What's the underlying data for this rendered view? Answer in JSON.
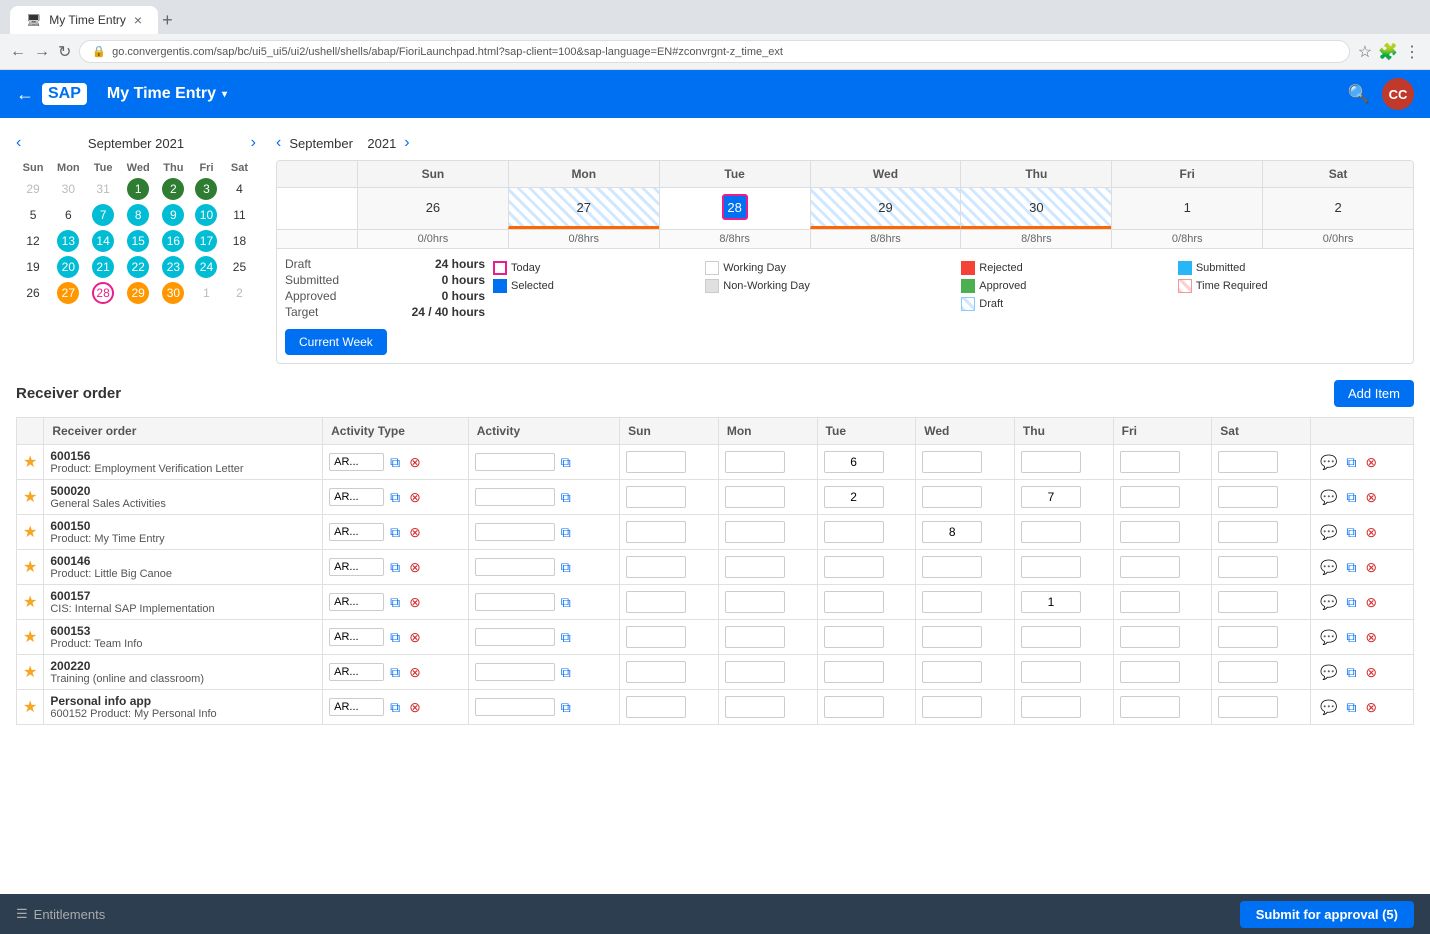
{
  "browser": {
    "tab_title": "My Time Entry",
    "url": "go.convergentis.com/sap/bc/ui5_ui5/ui2/ushell/shells/abap/FioriLaunchpad.html?sap-client=100&sap-language=EN#zconvrgnt-z_time_ext",
    "new_tab_label": "+",
    "back_label": "←",
    "forward_label": "→",
    "refresh_label": "↻"
  },
  "header": {
    "logo_text": "SAP",
    "back_label": "←",
    "title": "My Time Entry",
    "dropdown_arrow": "▾",
    "search_label": "🔍",
    "user_initials": "CC"
  },
  "mini_calendar": {
    "nav_prev": "‹",
    "nav_next": "›",
    "month": "September",
    "year": "2021",
    "day_headers": [
      "Sun",
      "Mon",
      "Tue",
      "Wed",
      "Thu",
      "Fri",
      "Sat"
    ],
    "weeks": [
      [
        {
          "d": "29",
          "style": "muted"
        },
        {
          "d": "30",
          "style": "muted"
        },
        {
          "d": "31",
          "style": "muted"
        },
        {
          "d": "1",
          "style": "green"
        },
        {
          "d": "2",
          "style": "green"
        },
        {
          "d": "3",
          "style": "green"
        },
        {
          "d": "4",
          "style": ""
        }
      ],
      [
        {
          "d": "5",
          "style": ""
        },
        {
          "d": "6",
          "style": ""
        },
        {
          "d": "7",
          "style": "teal"
        },
        {
          "d": "8",
          "style": "teal"
        },
        {
          "d": "9",
          "style": "teal"
        },
        {
          "d": "10",
          "style": "teal"
        },
        {
          "d": "11",
          "style": ""
        }
      ],
      [
        {
          "d": "12",
          "style": ""
        },
        {
          "d": "13",
          "style": "teal"
        },
        {
          "d": "14",
          "style": "teal"
        },
        {
          "d": "15",
          "style": "teal"
        },
        {
          "d": "16",
          "style": "teal"
        },
        {
          "d": "17",
          "style": "teal"
        },
        {
          "d": "18",
          "style": ""
        }
      ],
      [
        {
          "d": "19",
          "style": ""
        },
        {
          "d": "20",
          "style": "teal"
        },
        {
          "d": "21",
          "style": "teal"
        },
        {
          "d": "22",
          "style": "teal"
        },
        {
          "d": "23",
          "style": "teal"
        },
        {
          "d": "24",
          "style": "teal"
        },
        {
          "d": "25",
          "style": ""
        }
      ],
      [
        {
          "d": "26",
          "style": ""
        },
        {
          "d": "27",
          "style": "orange"
        },
        {
          "d": "28",
          "style": "today"
        },
        {
          "d": "29",
          "style": "orange"
        },
        {
          "d": "30",
          "style": "orange"
        },
        {
          "d": "1",
          "style": "muted"
        },
        {
          "d": "2",
          "style": "muted"
        }
      ]
    ]
  },
  "week_calendar": {
    "nav_prev": "‹",
    "nav_next": "›",
    "month": "September",
    "year": "2021",
    "day_columns": [
      "",
      "Sun",
      "Mon",
      "Tue",
      "Wed",
      "Thu",
      "Fri",
      "Sat"
    ],
    "dates": [
      "",
      "26",
      "27",
      "28",
      "29",
      "30",
      "1",
      "2"
    ],
    "hours_row": [
      "",
      "0/0hrs",
      "0/8hrs",
      "8/8hrs",
      "8/8hrs",
      "8/8hrs",
      "0/8hrs",
      "0/0hrs"
    ],
    "stats": {
      "draft_label": "Draft",
      "draft_value": "24 hours",
      "submitted_label": "Submitted",
      "submitted_value": "0 hours",
      "approved_label": "Approved",
      "approved_value": "0 hours",
      "target_label": "Target",
      "target_value": "24 / 40 hours"
    },
    "legend": [
      {
        "label": "Today",
        "style": "today"
      },
      {
        "label": "Working Day",
        "style": "working"
      },
      {
        "label": "Rejected",
        "style": "rejected"
      },
      {
        "label": "Submitted",
        "style": "submitted"
      },
      {
        "label": "Selected",
        "style": "selected"
      },
      {
        "label": "Non-Working Day",
        "style": "nonworking"
      },
      {
        "label": "Approved",
        "style": "approved"
      },
      {
        "label": "Time Required",
        "style": "timerequired"
      },
      {
        "label": "",
        "style": ""
      },
      {
        "label": "",
        "style": ""
      },
      {
        "label": "",
        "style": "draft"
      },
      {
        "label": "Draft",
        "style": "draft"
      }
    ],
    "current_week_btn": "Current Week"
  },
  "receiver_section": {
    "title": "Receiver order",
    "add_item_btn": "Add Item"
  },
  "table": {
    "headers": [
      "",
      "Receiver order",
      "Activity Type",
      "Activity",
      "Sun",
      "Mon",
      "Tue",
      "Wed",
      "Thu",
      "Fri",
      "Sat",
      ""
    ],
    "rows": [
      {
        "star": "★",
        "num": "600156",
        "desc": "Product: Employment Verification Letter",
        "activity_type": "AR...",
        "activity": "",
        "sun": "",
        "mon": "",
        "tue": "6",
        "wed": "",
        "thu": "",
        "fri": "",
        "sat": ""
      },
      {
        "star": "★",
        "num": "500020",
        "desc": "General Sales Activities",
        "activity_type": "AR...",
        "activity": "",
        "sun": "",
        "mon": "",
        "tue": "2",
        "wed": "",
        "thu": "7",
        "fri": "",
        "sat": ""
      },
      {
        "star": "★",
        "num": "600150",
        "desc": "Product: My Time Entry",
        "activity_type": "AR...",
        "activity": "",
        "sun": "",
        "mon": "",
        "tue": "",
        "wed": "8",
        "thu": "",
        "fri": "",
        "sat": ""
      },
      {
        "star": "★",
        "num": "600146",
        "desc": "Product: Little Big Canoe",
        "activity_type": "AR...",
        "activity": "",
        "sun": "",
        "mon": "",
        "tue": "",
        "wed": "",
        "thu": "",
        "fri": "",
        "sat": ""
      },
      {
        "star": "★",
        "num": "600157",
        "desc": "CIS: Internal SAP Implementation",
        "activity_type": "AR...",
        "activity": "",
        "sun": "",
        "mon": "",
        "tue": "",
        "wed": "",
        "thu": "1",
        "fri": "",
        "sat": ""
      },
      {
        "star": "★",
        "num": "600153",
        "desc": "Product: Team Info",
        "activity_type": "AR...",
        "activity": "",
        "sun": "",
        "mon": "",
        "tue": "",
        "wed": "",
        "thu": "",
        "fri": "",
        "sat": ""
      },
      {
        "star": "★",
        "num": "200220",
        "desc": "Training (online and classroom)",
        "activity_type": "AR...",
        "activity": "",
        "sun": "",
        "mon": "",
        "tue": "",
        "wed": "",
        "thu": "",
        "fri": "",
        "sat": ""
      },
      {
        "star": "★",
        "num": "Personal info app",
        "desc": "600152 Product: My Personal Info",
        "activity_type": "AR...",
        "activity": "",
        "sun": "",
        "mon": "",
        "tue": "",
        "wed": "",
        "thu": "",
        "fri": "",
        "sat": ""
      }
    ]
  },
  "bottom_bar": {
    "entitlements_icon": "☰",
    "entitlements_label": "Entitlements",
    "submit_btn": "Submit for approval (5)"
  }
}
